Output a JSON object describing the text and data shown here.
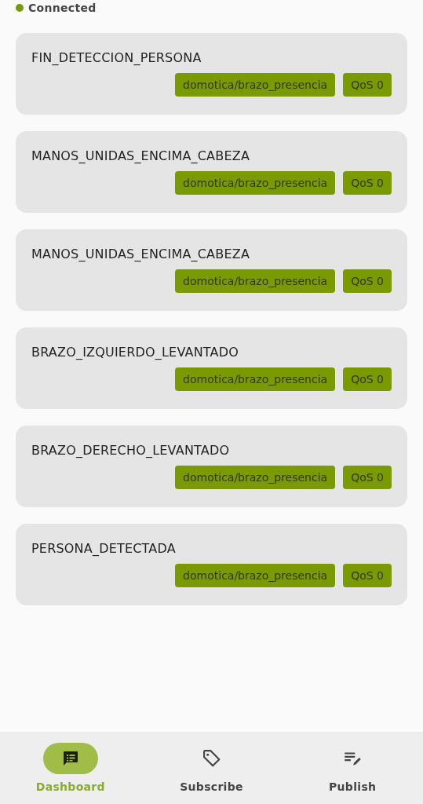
{
  "status": {
    "label": "Connected",
    "color": "#7a9a01"
  },
  "messages": [
    {
      "payload": "FIN_DETECCION_PERSONA",
      "topic": "domotica/brazo_presencia",
      "qos": "QoS 0"
    },
    {
      "payload": "MANOS_UNIDAS_ENCIMA_CABEZA",
      "topic": "domotica/brazo_presencia",
      "qos": "QoS 0"
    },
    {
      "payload": "MANOS_UNIDAS_ENCIMA_CABEZA",
      "topic": "domotica/brazo_presencia",
      "qos": "QoS 0"
    },
    {
      "payload": "BRAZO_IZQUIERDO_LEVANTADO",
      "topic": "domotica/brazo_presencia",
      "qos": "QoS 0"
    },
    {
      "payload": "BRAZO_DERECHO_LEVANTADO",
      "topic": "domotica/brazo_presencia",
      "qos": "QoS 0"
    },
    {
      "payload": "PERSONA_DETECTADA",
      "topic": "domotica/brazo_presencia",
      "qos": "QoS 0"
    }
  ],
  "nav": [
    {
      "label": "Dashboard",
      "kind": "dashboard",
      "selected": true
    },
    {
      "label": "Subscribe",
      "kind": "subscribe",
      "selected": false
    },
    {
      "label": "Publish",
      "kind": "publish",
      "selected": false
    }
  ]
}
